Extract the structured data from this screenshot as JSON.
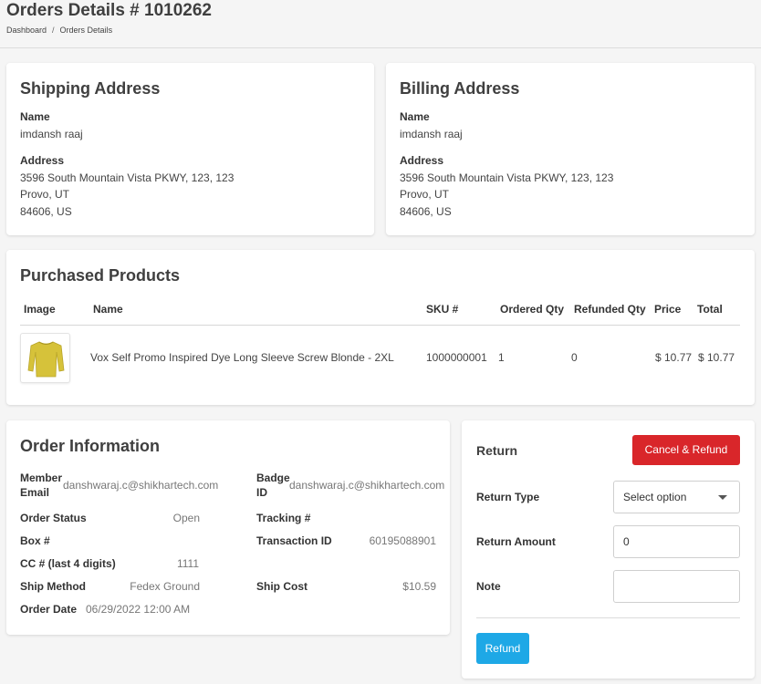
{
  "header": {
    "title": "Orders Details # 1010262",
    "breadcrumb": [
      "Dashboard",
      "Orders Details"
    ],
    "breadcrumb_sep": "/"
  },
  "shipping": {
    "title": "Shipping Address",
    "name_label": "Name",
    "name": "imdansh raaj",
    "address_label": "Address",
    "line1": "3596 South Mountain Vista PKWY, 123, 123",
    "line2": "Provo, UT",
    "line3": "84606, US"
  },
  "billing": {
    "title": "Billing Address",
    "name_label": "Name",
    "name": "imdansh raaj",
    "address_label": "Address",
    "line1": "3596 South Mountain Vista PKWY, 123, 123",
    "line2": "Provo, UT",
    "line3": "84606, US"
  },
  "products": {
    "title": "Purchased Products",
    "columns": [
      "Image",
      "Name",
      "SKU #",
      "Ordered Qty",
      "Refunded Qty",
      "Price",
      "Total"
    ],
    "rows": [
      {
        "image_icon": "yellow-long-sleeve-shirt",
        "name": "Vox Self Promo Inspired Dye Long Sleeve Screw Blonde - 2XL",
        "sku": "1000000001",
        "ordered_qty": "1",
        "refunded_qty": "0",
        "price": "$ 10.77",
        "total": "$ 10.77"
      }
    ]
  },
  "order_info": {
    "title": "Order Information",
    "member_email_label": "Member Email",
    "member_email": "danshwaraj.c@shikhartech.com",
    "badge_id_label": "Badge ID",
    "badge_id": "danshwaraj.c@shikhartech.com",
    "order_status_label": "Order Status",
    "order_status": "Open",
    "tracking_label": "Tracking #",
    "tracking": "",
    "box_label": "Box #",
    "box": "",
    "transaction_label": "Transaction ID",
    "transaction": "60195088901",
    "cc_label": "CC # (last 4 digits)",
    "cc": "1111",
    "ship_method_label": "Ship Method",
    "ship_method": "Fedex Ground",
    "ship_cost_label": "Ship Cost",
    "ship_cost": "$10.59",
    "order_date_label": "Order Date",
    "order_date": "06/29/2022 12:00 AM"
  },
  "return_panel": {
    "title": "Return",
    "cancel_refund_label": "Cancel & Refund",
    "return_type_label": "Return Type",
    "return_type_value": "Select option",
    "return_amount_label": "Return Amount",
    "return_amount_value": "0",
    "note_label": "Note",
    "note_value": "",
    "refund_label": "Refund"
  },
  "colors": {
    "danger": "#d9262a",
    "primary": "#1ea8e6",
    "product_yellow": "#d6c23a"
  }
}
